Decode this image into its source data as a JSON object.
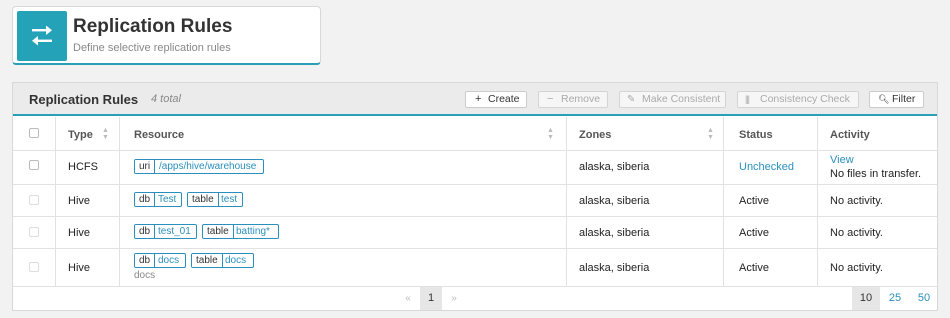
{
  "header": {
    "title": "Replication Rules",
    "subtitle": "Define selective replication rules",
    "icon": "replication-arrows-icon"
  },
  "panel": {
    "title": "Replication Rules",
    "count": "4 total"
  },
  "toolbar": {
    "create": "Create",
    "remove": "Remove",
    "make_consistent": "Make Consistent",
    "consistency_check": "Consistency Check",
    "filter": "Filter"
  },
  "columns": {
    "type": "Type",
    "resource": "Resource",
    "zones": "Zones",
    "status": "Status",
    "activity": "Activity"
  },
  "rows": [
    {
      "type": "HCFS",
      "resource": [
        {
          "key": "uri",
          "value": "/apps/hive/warehouse"
        }
      ],
      "zones": "alaska, siberia",
      "status": "Unchecked",
      "activity_link": "View",
      "activity": "No files in transfer."
    },
    {
      "type": "Hive",
      "resource": [
        {
          "key": "db",
          "value": "Test"
        },
        {
          "key": "table",
          "value": "test"
        }
      ],
      "zones": "alaska, siberia",
      "status": "Active",
      "activity": "No activity."
    },
    {
      "type": "Hive",
      "resource": [
        {
          "key": "db",
          "value": "test_01"
        },
        {
          "key": "table",
          "value": "batting*"
        }
      ],
      "zones": "alaska, siberia",
      "status": "Active",
      "activity": "No activity."
    },
    {
      "type": "Hive",
      "resource": [
        {
          "key": "db",
          "value": "docs"
        },
        {
          "key": "table",
          "value": "docs"
        }
      ],
      "resource_note": "docs",
      "zones": "alaska, siberia",
      "status": "Active",
      "activity": "No activity."
    }
  ],
  "pagination": {
    "prev": "«",
    "current": "1",
    "next": "»",
    "page_sizes": [
      "10",
      "25",
      "50"
    ],
    "selected_page_size": "10"
  },
  "colors": {
    "accent": "#24a2b8",
    "link": "#2a8fbd"
  }
}
